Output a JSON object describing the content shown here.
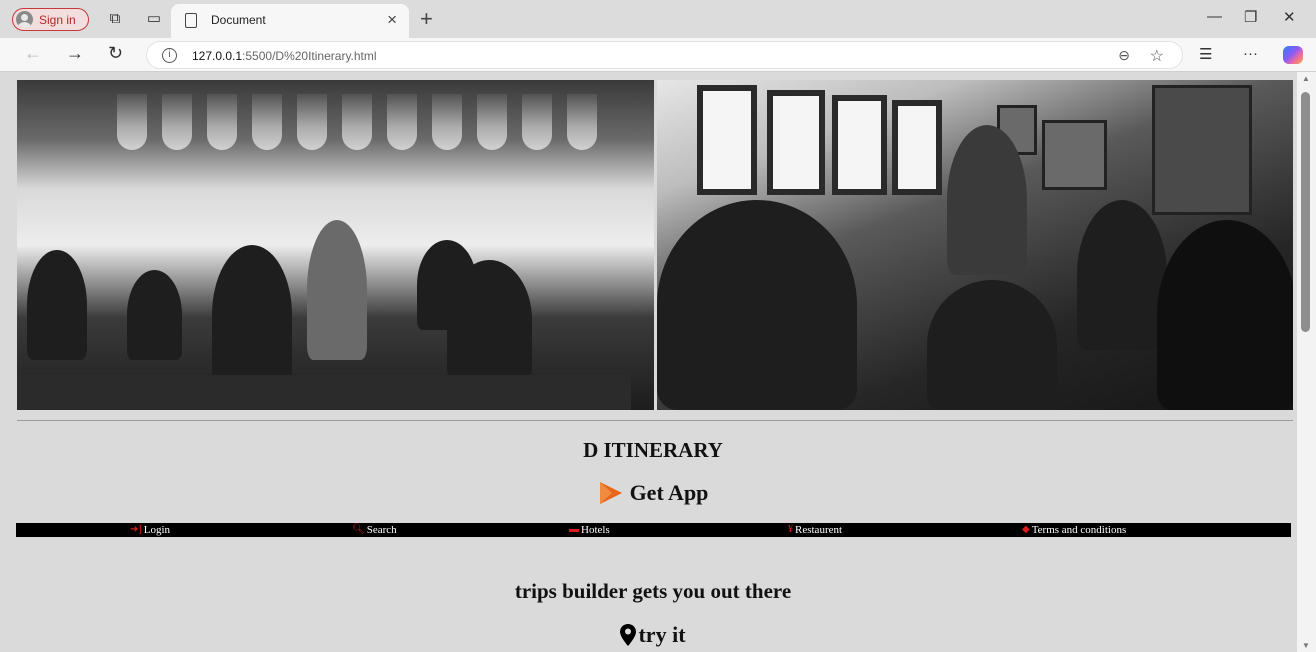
{
  "browser": {
    "signin_label": "Sign in",
    "tab_title": "Document",
    "url_host": "127.0.0.1",
    "url_rest": ":5500/D%20Itinerary.html"
  },
  "page": {
    "brand": "D ITINERARY",
    "get_app": "Get App",
    "accent_color": "#e8651a",
    "menu": [
      {
        "icon": "login-icon",
        "label": "Login"
      },
      {
        "icon": "search-icon",
        "label": "Search"
      },
      {
        "icon": "bed-icon",
        "label": "Hotels"
      },
      {
        "icon": "utensils-icon",
        "label": "Restaurent"
      },
      {
        "icon": "handshake-icon",
        "label": "Terms and conditions"
      }
    ],
    "tagline": "trips builder gets you out there",
    "try_it": "try it"
  }
}
